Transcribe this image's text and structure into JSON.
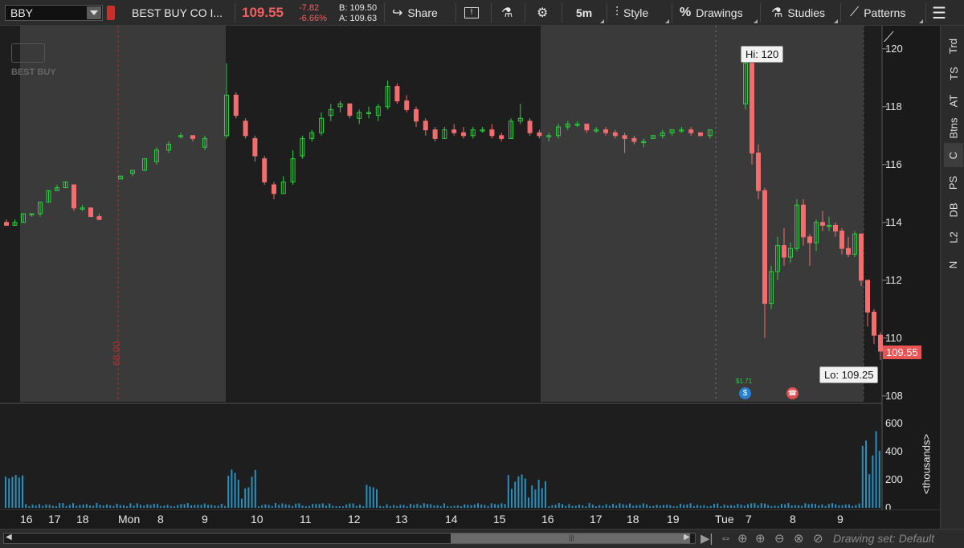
{
  "toolbar": {
    "symbol": "BBY",
    "company": "BEST BUY CO I...",
    "last_price": "109.55",
    "net_change": "-7.82",
    "pct_change": "-6.66%",
    "bid": "B: 109.50",
    "ask": "A: 109.63",
    "share_label": "Share",
    "timeframe": "5m",
    "style_label": "Style",
    "drawings_label": "Drawings",
    "studies_label": "Studies",
    "patterns_label": "Patterns"
  },
  "chart": {
    "watermark": "BEST BUY",
    "price_ticks": [
      "120",
      "118",
      "116",
      "114",
      "112",
      "110",
      "108"
    ],
    "high_label": "Hi: 120",
    "low_label": "Lo: 109.25",
    "last_price_label": "109.55",
    "vertical_marker_text": "68.00",
    "event_text": "$1.71",
    "volume_ticks": [
      "600",
      "400",
      "200",
      "0"
    ],
    "volume_unit": "<thousands>",
    "colors": {
      "up": "#2ecc40",
      "down": "#f26d6d",
      "volume": "#2a8fbd",
      "bg_dark": "#1e1e1e",
      "bg_light": "#3a3a3a"
    }
  },
  "right_tabs": [
    "Trd",
    "TS",
    "AT",
    "Btns",
    "C",
    "PS",
    "DB",
    "L2",
    "N"
  ],
  "time_axis": [
    "16",
    "17",
    "18",
    "Mon",
    "8",
    "9",
    "10",
    "11",
    "12",
    "13",
    "14",
    "15",
    "16",
    "17",
    "18",
    "19",
    "Tue",
    "7",
    "8",
    "9"
  ],
  "bottom": {
    "drawing_set": "Drawing set: Default"
  },
  "chart_data": {
    "type": "candlestick",
    "ylim": [
      107.8,
      120.8
    ],
    "candles": [
      [
        114.0,
        114.1,
        113.9,
        113.9
      ],
      [
        113.9,
        114.1,
        113.9,
        114.0
      ],
      [
        114.0,
        114.3,
        114.0,
        114.3
      ],
      [
        114.3,
        114.3,
        114.2,
        114.3
      ],
      [
        114.3,
        114.7,
        114.2,
        114.7
      ],
      [
        114.7,
        115.1,
        114.7,
        115.1
      ],
      [
        115.1,
        115.3,
        115.1,
        115.2
      ],
      [
        115.2,
        115.4,
        115.2,
        115.4
      ],
      [
        115.3,
        115.3,
        114.4,
        114.5
      ],
      [
        114.5,
        114.6,
        114.4,
        114.5
      ],
      [
        114.5,
        114.5,
        114.2,
        114.2
      ],
      [
        114.2,
        114.3,
        114.1,
        114.1
      ],
      [
        115.5,
        115.6,
        115.5,
        115.6
      ],
      [
        115.7,
        115.8,
        115.6,
        115.8
      ],
      [
        115.8,
        116.2,
        115.8,
        116.2
      ],
      [
        116.1,
        116.6,
        116.0,
        116.5
      ],
      [
        116.5,
        116.8,
        116.4,
        116.7
      ],
      [
        117.0,
        117.1,
        116.9,
        117.0
      ],
      [
        117.0,
        117.0,
        116.8,
        116.9
      ],
      [
        116.6,
        117.0,
        116.5,
        116.9
      ],
      [
        117.0,
        119.5,
        116.9,
        118.4
      ],
      [
        118.4,
        118.5,
        117.6,
        117.7
      ],
      [
        117.5,
        117.6,
        116.9,
        117.0
      ],
      [
        116.9,
        117.0,
        116.1,
        116.3
      ],
      [
        116.2,
        116.3,
        115.3,
        115.4
      ],
      [
        115.3,
        115.4,
        114.8,
        115.0
      ],
      [
        115.0,
        115.6,
        115.0,
        115.4
      ],
      [
        115.4,
        116.5,
        115.3,
        116.2
      ],
      [
        116.3,
        117.0,
        116.2,
        116.9
      ],
      [
        116.9,
        117.2,
        116.8,
        117.1
      ],
      [
        117.1,
        117.8,
        117.0,
        117.6
      ],
      [
        117.7,
        118.1,
        117.5,
        117.9
      ],
      [
        118.0,
        118.2,
        117.8,
        118.1
      ],
      [
        118.1,
        118.1,
        117.6,
        117.7
      ],
      [
        117.6,
        117.9,
        117.4,
        117.8
      ],
      [
        117.8,
        118.0,
        117.6,
        117.8
      ],
      [
        117.7,
        118.1,
        117.5,
        118.0
      ],
      [
        118.0,
        118.9,
        117.9,
        118.7
      ],
      [
        118.7,
        118.8,
        118.1,
        118.2
      ],
      [
        118.2,
        118.4,
        117.8,
        117.9
      ],
      [
        117.9,
        118.0,
        117.3,
        117.5
      ],
      [
        117.5,
        117.6,
        117.0,
        117.2
      ],
      [
        117.2,
        117.3,
        116.8,
        116.9
      ],
      [
        116.9,
        117.3,
        116.9,
        117.2
      ],
      [
        117.2,
        117.4,
        117.0,
        117.1
      ],
      [
        117.1,
        117.3,
        116.9,
        117.0
      ],
      [
        117.0,
        117.3,
        116.9,
        117.2
      ],
      [
        117.2,
        117.3,
        117.1,
        117.2
      ],
      [
        117.2,
        117.4,
        116.9,
        117.0
      ],
      [
        117.0,
        117.1,
        116.8,
        116.9
      ],
      [
        116.9,
        117.6,
        116.9,
        117.5
      ],
      [
        117.5,
        118.1,
        117.4,
        117.6
      ],
      [
        117.5,
        117.6,
        117.0,
        117.1
      ],
      [
        117.1,
        117.2,
        116.9,
        117.0
      ],
      [
        117.0,
        117.1,
        116.8,
        117.0
      ],
      [
        117.0,
        117.4,
        116.9,
        117.3
      ],
      [
        117.3,
        117.5,
        117.2,
        117.4
      ],
      [
        117.4,
        117.5,
        117.3,
        117.4
      ],
      [
        117.4,
        117.4,
        117.1,
        117.2
      ],
      [
        117.2,
        117.3,
        117.1,
        117.2
      ],
      [
        117.2,
        117.3,
        117.0,
        117.1
      ],
      [
        117.1,
        117.2,
        116.9,
        117.0
      ],
      [
        117.0,
        117.1,
        116.4,
        116.9
      ],
      [
        116.9,
        117.0,
        116.7,
        116.8
      ],
      [
        116.8,
        116.9,
        116.6,
        116.8
      ],
      [
        116.9,
        117.0,
        116.9,
        117.0
      ],
      [
        117.0,
        117.2,
        116.9,
        117.1
      ],
      [
        117.1,
        117.2,
        117.0,
        117.2
      ],
      [
        117.2,
        117.3,
        117.1,
        117.2
      ],
      [
        117.2,
        117.3,
        117.0,
        117.1
      ],
      [
        117.1,
        117.1,
        117.0,
        117.0
      ],
      [
        117.0,
        117.2,
        116.9,
        117.2
      ],
      [
        118.1,
        120.0,
        117.9,
        119.5
      ],
      [
        119.5,
        119.6,
        116.0,
        116.4
      ],
      [
        116.4,
        116.7,
        114.8,
        115.1
      ],
      [
        115.1,
        115.2,
        110.0,
        111.2
      ],
      [
        111.2,
        112.5,
        111.0,
        112.3
      ],
      [
        112.3,
        113.5,
        112.0,
        113.2
      ],
      [
        113.2,
        113.8,
        112.5,
        112.8
      ],
      [
        112.8,
        113.3,
        112.6,
        113.1
      ],
      [
        113.1,
        114.8,
        113.0,
        114.6
      ],
      [
        114.6,
        114.8,
        113.2,
        113.5
      ],
      [
        113.5,
        113.6,
        112.5,
        113.3
      ],
      [
        113.3,
        114.1,
        113.0,
        114.0
      ],
      [
        114.0,
        114.4,
        113.7,
        113.9
      ],
      [
        113.9,
        114.2,
        113.7,
        113.9
      ],
      [
        113.9,
        114.0,
        113.5,
        113.7
      ],
      [
        113.7,
        113.8,
        112.9,
        113.1
      ],
      [
        113.1,
        113.5,
        112.8,
        112.9
      ],
      [
        112.9,
        113.7,
        112.8,
        113.6
      ],
      [
        113.6,
        113.6,
        111.8,
        112.0
      ],
      [
        112.0,
        112.0,
        110.4,
        110.9
      ],
      [
        110.9,
        111.0,
        109.8,
        110.1
      ],
      [
        110.1,
        110.2,
        109.25,
        109.55
      ]
    ],
    "volume_thousands_approx": [
      10,
      240,
      170,
      50,
      315,
      220,
      210,
      660,
      480,
      330
    ]
  }
}
